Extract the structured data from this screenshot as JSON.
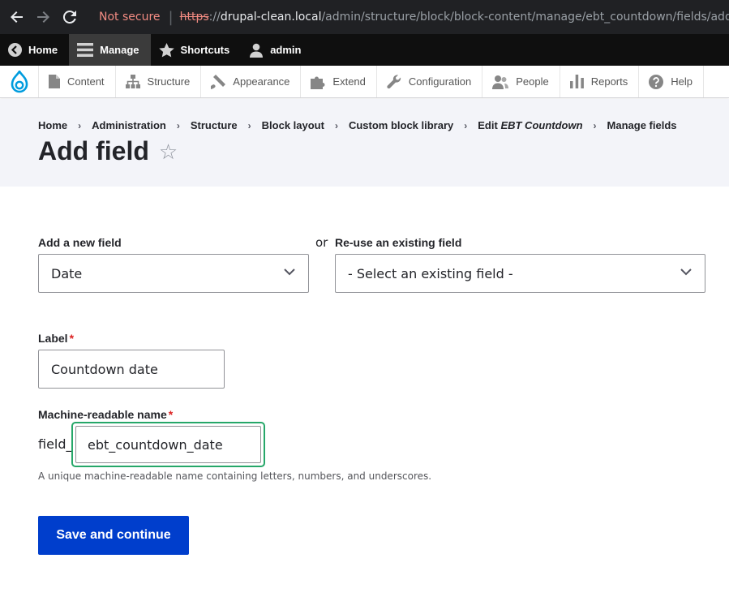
{
  "browser": {
    "security_label": "Not secure",
    "url_scheme": "https",
    "url_separator": "://",
    "url_host": "drupal-clean.local",
    "url_path": "/admin/structure/block/block-content/manage/ebt_countdown/fields/add-field"
  },
  "toolbar": {
    "items": [
      {
        "label": "Home",
        "icon": "drupal-drop-back-icon"
      },
      {
        "label": "Manage",
        "icon": "hamburger-icon",
        "active": true
      },
      {
        "label": "Shortcuts",
        "icon": "star-icon"
      },
      {
        "label": "admin",
        "icon": "user-icon"
      }
    ]
  },
  "tray": {
    "logo": "drupal-logo",
    "items": [
      {
        "label": "Content",
        "icon": "document-icon"
      },
      {
        "label": "Structure",
        "icon": "sitemap-icon"
      },
      {
        "label": "Appearance",
        "icon": "paintbrush-icon"
      },
      {
        "label": "Extend",
        "icon": "puzzle-icon"
      },
      {
        "label": "Configuration",
        "icon": "wrench-icon"
      },
      {
        "label": "People",
        "icon": "people-icon"
      },
      {
        "label": "Reports",
        "icon": "bar-chart-icon"
      },
      {
        "label": "Help",
        "icon": "help-icon"
      }
    ]
  },
  "breadcrumb": {
    "items": [
      "Home",
      "Administration",
      "Structure",
      "Block layout",
      "Custom block library"
    ],
    "edit_prefix": "Edit ",
    "edit_name": "EBT Countdown",
    "last": "Manage fields",
    "separator": "›"
  },
  "page": {
    "title": "Add field",
    "favorite_star": "☆"
  },
  "form": {
    "add_new_label": "Add a new field",
    "add_new_value": "Date",
    "or_text": "or",
    "reuse_label": "Re-use an existing field",
    "reuse_value": "- Select an existing field -",
    "label_label": "Label",
    "label_value": "Countdown date",
    "required_marker": "*",
    "machine_label": "Machine-readable name",
    "machine_prefix": "field_",
    "machine_value": "ebt_countdown_date",
    "machine_description": "A unique machine-readable name containing letters, numbers, and underscores.",
    "submit_label": "Save and continue"
  },
  "colors": {
    "primary_button": "#003ecc",
    "focus_ring": "#26a769",
    "required": "#dc2323",
    "toolbar_bg": "#0f0f0f",
    "header_bg": "#f3f4f9"
  }
}
